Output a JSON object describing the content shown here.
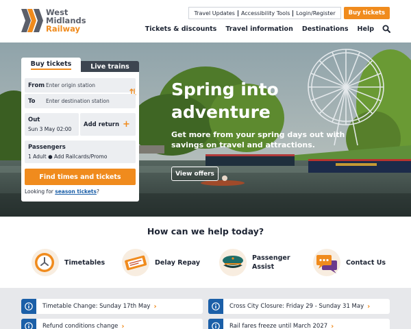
{
  "brand": {
    "line1": "West",
    "line2": "Midlands",
    "line3": "Railway",
    "accent": "#f08b1d",
    "dark": "#3d4550",
    "link_blue": "#1b5fa8"
  },
  "toplinks": [
    "Travel Updates",
    "Accessibility Tools",
    "Login/Register"
  ],
  "buy_top": "Buy tickets",
  "nav": [
    "Tickets & discounts",
    "Travel information",
    "Destinations",
    "Help"
  ],
  "hero": {
    "title_line1": "Spring into",
    "title_line2": "adventure",
    "subtitle": "Get more from your spring days out with savings on travel and attractions.",
    "button": "View offers"
  },
  "booking": {
    "tab_buy": "Buy tickets",
    "tab_live": "Live trains",
    "from_label": "From",
    "from_placeholder": "Enter origin station",
    "to_label": "To",
    "to_placeholder": "Enter destination station",
    "out_label": "Out",
    "out_value": "Sun 3 May 02:00",
    "add_return": "Add return",
    "passengers_label": "Passengers",
    "passengers_value": "1 Adult",
    "railcards": "Add Railcards/Promo",
    "find_button": "Find times and tickets",
    "season_prefix": "Looking for ",
    "season_link": "season tickets",
    "season_suffix": "?"
  },
  "help": {
    "title": "How can we help today?",
    "items": [
      {
        "label": "Timetables",
        "icon": "clock-icon"
      },
      {
        "label": "Delay Repay",
        "icon": "ticket-icon"
      },
      {
        "label_line1": "Passenger",
        "label_line2": "Assist",
        "icon": "guard-cap-icon"
      },
      {
        "label": "Contact Us",
        "icon": "chat-bubble-icon"
      }
    ]
  },
  "notices": [
    "Timetable Change: Sunday 17th May",
    "Cross City Closure: Friday 29 - Sunday 31 May",
    "Refund conditions change",
    "Rail fares freeze until March 2027"
  ]
}
